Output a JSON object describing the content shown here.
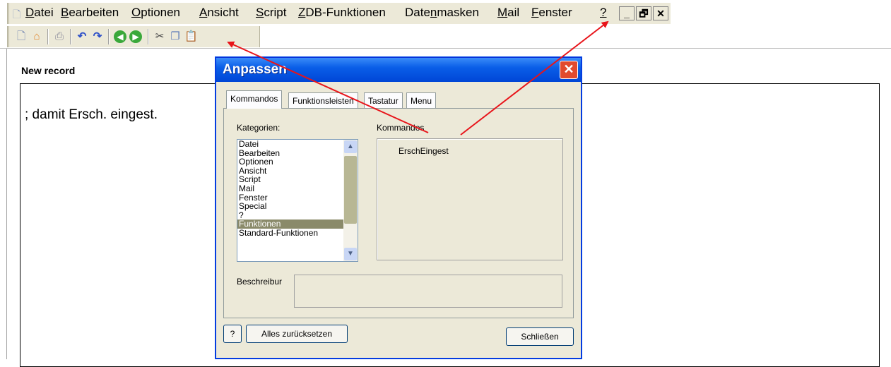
{
  "menubar": {
    "items": [
      {
        "label_pre": "",
        "hot": "D",
        "label_post": "atei"
      },
      {
        "label_pre": "",
        "hot": "B",
        "label_post": "earbeiten"
      },
      {
        "label_pre": "",
        "hot": "O",
        "label_post": "ptionen"
      },
      {
        "label_pre": "",
        "hot": "A",
        "label_post": "nsicht"
      },
      {
        "label_pre": "",
        "hot": "S",
        "label_post": "cript"
      },
      {
        "label_pre": "",
        "hot": "Z",
        "label_post": "DB-Funktionen"
      },
      {
        "label_pre": "Date",
        "hot": "n",
        "label_post": "masken"
      },
      {
        "label_pre": "",
        "hot": "M",
        "label_post": "ail"
      },
      {
        "label_pre": "",
        "hot": "F",
        "label_post": "enster"
      },
      {
        "label_pre": "",
        "hot": "?",
        "label_post": ""
      }
    ],
    "minimize_glyph": "_",
    "restore_glyph": "🗗",
    "close_glyph": "✕"
  },
  "toolbar": {
    "icons": [
      "new-icon",
      "home-icon",
      "print-icon",
      "undo-icon",
      "redo-icon",
      "back-icon",
      "forward-icon",
      "cut-icon",
      "copy-icon",
      "paste-icon"
    ]
  },
  "record": {
    "heading": "New record",
    "text": "; damit Ersch. eingest."
  },
  "dialog": {
    "title": "Anpassen",
    "close_glyph": "✕",
    "tabs": [
      "Kommandos",
      "Funktionsleisten",
      "Tastatur",
      "Menu"
    ],
    "categories_label": "Kategorien:",
    "commands_label": "Kommandos",
    "categories": [
      "Datei",
      "Bearbeiten",
      "Optionen",
      "Ansicht",
      "Script",
      "Mail",
      "Fenster",
      "Special",
      "?",
      "Funktionen",
      "Standard-Funktionen"
    ],
    "selected_category": "Funktionen",
    "commands": [
      "ErschEingest"
    ],
    "description_label": "Beschreibur",
    "help_button": "?",
    "reset_button": "Alles zurücksetzen",
    "close_button": "Schließen"
  },
  "colors": {
    "arrow": "#e8141a",
    "titlebar": "#0a5ee8",
    "selection": "#8a8a6a"
  }
}
